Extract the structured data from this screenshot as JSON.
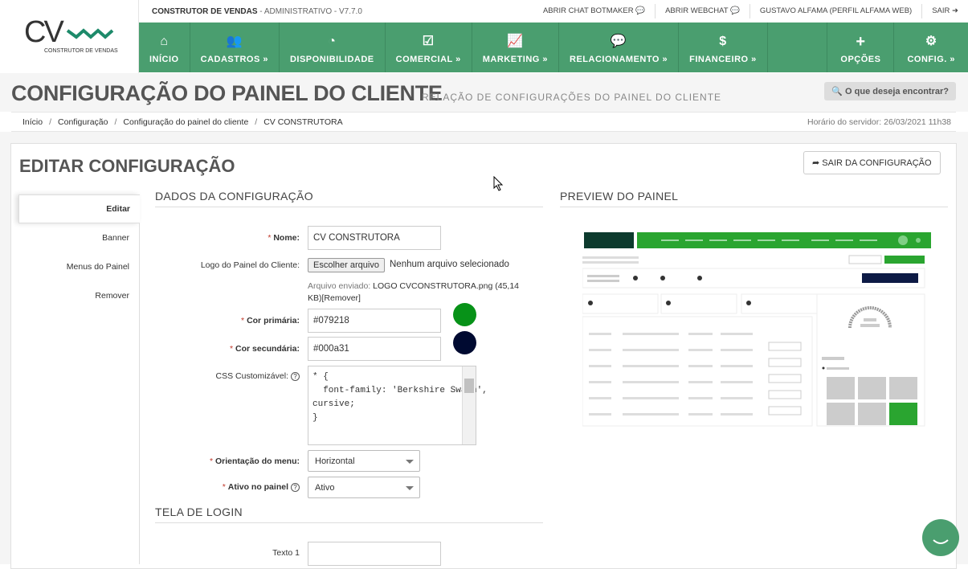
{
  "app": {
    "name": "CONSTRUTOR DE VENDAS",
    "subtitle": "- ADMINISTRATIVO - V7.7.0",
    "logo_text": "CONSTRUTOR DE VENDAS",
    "logo_letters": "CV"
  },
  "toplinks": [
    {
      "label": "ABRIR CHAT BOTMAKER"
    },
    {
      "label": "ABRIR WEBCHAT"
    },
    {
      "label": "GUSTAVO ALFAMA (PERFIL ALFAMA WEB)"
    },
    {
      "label": "SAIR"
    }
  ],
  "nav": {
    "items": [
      {
        "label": "INÍCIO",
        "icon": "home-icon"
      },
      {
        "label": "CADASTROS »",
        "icon": "users-icon"
      },
      {
        "label": "DISPONIBILIDADE",
        "icon": "dashboard-icon"
      },
      {
        "label": "COMERCIAL »",
        "icon": "checkbox-icon"
      },
      {
        "label": "MARKETING »",
        "icon": "chart-icon"
      },
      {
        "label": "RELACIONAMENTO »",
        "icon": "chat-icon"
      },
      {
        "label": "FINANCEIRO »",
        "icon": "dollar-icon"
      }
    ],
    "right": [
      {
        "label": "OPÇÕES",
        "icon": "plus-icon"
      },
      {
        "label": "CONFIG. »",
        "icon": "gear-icon"
      }
    ]
  },
  "page": {
    "title": "CONFIGURAÇÃO DO PAINEL DO CLIENTE",
    "subtitle": "RELAÇÃO DE CONFIGURAÇÕES DO PAINEL DO CLIENTE",
    "search_label": "O que deseja encontrar?"
  },
  "breadcrumb": {
    "items": [
      "Início",
      "Configuração",
      "Configuração do painel do cliente",
      "CV CONSTRUTORA"
    ],
    "server_time": "Horário do servidor: 26/03/2021 11h38"
  },
  "edit": {
    "title": "EDITAR CONFIGURAÇÃO",
    "exit_label": "SAIR DA CONFIGURAÇÃO"
  },
  "tabs": [
    {
      "label": "Editar"
    },
    {
      "label": "Banner"
    },
    {
      "label": "Menus do Painel"
    },
    {
      "label": "Remover"
    }
  ],
  "form": {
    "section_title": "DADOS DA CONFIGURAÇÃO",
    "preview_title": "PREVIEW DO PAINEL",
    "name_label": "Nome:",
    "name_value": "CV CONSTRUTORA",
    "logo_label": "Logo do Painel do Cliente:",
    "file_button": "Escolher arquivo",
    "file_none": "Nenhum arquivo selecionado",
    "file_sent_label": "Arquivo enviado:",
    "file_sent_name": "LOGO CVCONSTRUTORA.png (45,14 KB)",
    "file_remove": "[Remover]",
    "primary_label": "Cor primária:",
    "primary_value": "#079218",
    "secondary_label": "Cor secundária:",
    "secondary_value": "#000a31",
    "css_label": "CSS Customizável:",
    "css_value": "* {\n  font-family: 'Berkshire Swash',\ncursive;\n}",
    "orientation_label": "Orientação do menu:",
    "orientation_value": "Horizontal",
    "active_label": "Ativo no painel",
    "active_value": "Ativo",
    "login_section": "TELA DE LOGIN",
    "text1_label": "Texto 1"
  },
  "colors": {
    "brand_green": "#4a9e6f",
    "primary": "#079218",
    "secondary": "#000a31"
  }
}
